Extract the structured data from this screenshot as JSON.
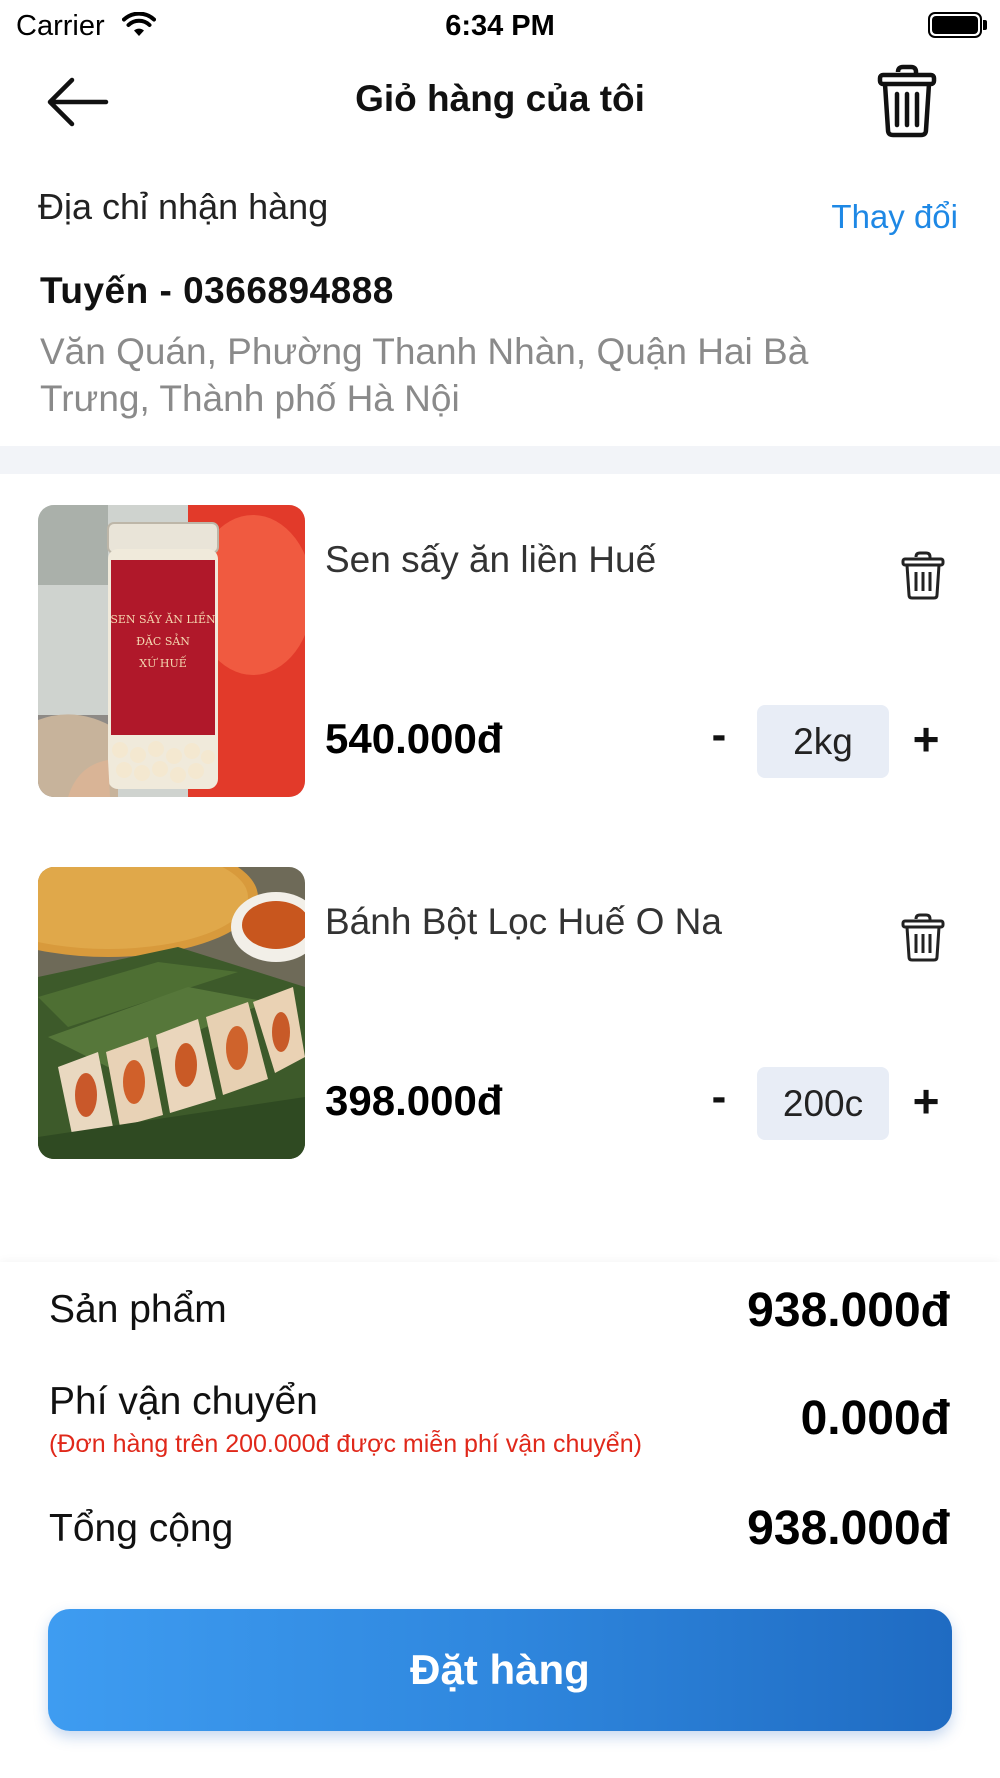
{
  "status_bar": {
    "carrier": "Carrier",
    "time": "6:34 PM"
  },
  "nav": {
    "title": "Giỏ hàng của tôi",
    "back_icon": "arrow-left-icon",
    "trash_icon": "trash-icon"
  },
  "address": {
    "label": "Địa chỉ nhận hàng",
    "change_label": "Thay đổi",
    "name_phone": "Tuyến - 0366894888",
    "detail": "Văn Quán, Phường Thanh Nhàn, Quận Hai Bà Trưng, Thành phố Hà Nội"
  },
  "items": [
    {
      "name": "Sen sấy ăn liền Huế",
      "price": "540.000đ",
      "qty_minus": "-",
      "quantity": "2kg",
      "qty_plus": "+"
    },
    {
      "name": "Bánh Bột Lọc Huế O Na",
      "price": "398.000đ",
      "qty_minus": "-",
      "quantity": "200c",
      "qty_plus": "+"
    }
  ],
  "summary": {
    "products_label": "Sản phẩm",
    "products_value": "938.000đ",
    "shipping_label": "Phí vận chuyển",
    "shipping_note": "(Đơn hàng trên 200.000đ được miễn phí vận chuyển)",
    "shipping_value": "0.000đ",
    "total_label": "Tổng cộng",
    "total_value": "938.000đ"
  },
  "order_button": "Đặt hàng",
  "colors": {
    "accent": "#1e88e5",
    "note_red": "#e0281a",
    "qty_bg": "#e8edf6"
  }
}
